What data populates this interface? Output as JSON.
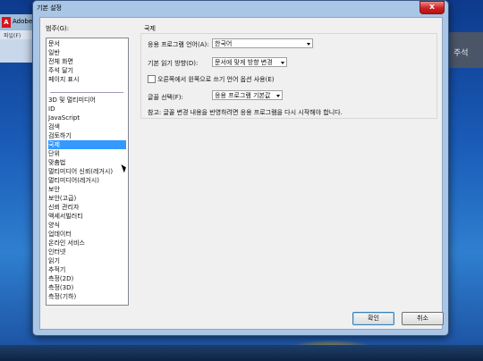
{
  "background": {
    "app_title": "Adobe",
    "menu_file": "파일(F)",
    "right_panel_label": "주석"
  },
  "dialog": {
    "title": "기본 설정",
    "close_glyph": "x"
  },
  "categories": {
    "label": "범주(G):",
    "top_items": [
      "문서",
      "일반",
      "전체 화면",
      "주석 달기",
      "페이지 표시"
    ],
    "items": [
      "3D 및 멀티미디어",
      "ID",
      "JavaScript",
      "검색",
      "검토하기",
      "국제",
      "단위",
      "맞춤법",
      "멀티미디어 신뢰(레거시)",
      "멀티미디어(레거시)",
      "보안",
      "보안(고급)",
      "신뢰 관리자",
      "액세서빌러티",
      "양식",
      "업데이터",
      "온라인 서비스",
      "인터넷",
      "읽기",
      "추적기",
      "측정(2D)",
      "측정(3D)",
      "측정(기하)"
    ],
    "selected": "국제"
  },
  "international": {
    "section_title": "국제",
    "app_language_label": "응용 프로그램 언어(A):",
    "app_language_value": "한국어",
    "reading_direction_label": "기본 읽기 방향(D):",
    "reading_direction_value": "문서에 맞게 방향 변경",
    "rtl_checkbox_label": "오른쪽에서 왼쪽으로 쓰기 언어 옵션 사용(E)",
    "rtl_checked": false,
    "font_select_label": "글꼴 선택(F):",
    "font_select_value": "응용 프로그램 기본값",
    "note": "참고: 글꼴 변경 내용을 반영하려면 응용 프로그램을 다시 시작해야 합니다."
  },
  "buttons": {
    "ok": "확인",
    "cancel": "취소"
  }
}
